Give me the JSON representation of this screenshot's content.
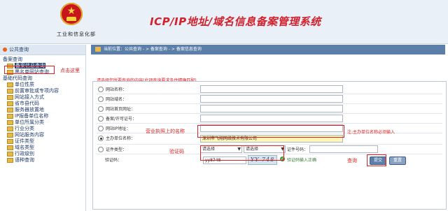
{
  "header": {
    "ministry": "工业和信息化部",
    "title": "ICP/IP地址/域名信息备案管理系统"
  },
  "sidebar": {
    "heading": "公共查询",
    "groups": [
      {
        "title": "备案查询",
        "items": [
          "备案信息查询",
          "黑名单网站查询"
        ]
      },
      {
        "title": "基础代码查询",
        "items": [
          "单位性质",
          "前置审批或专项内容",
          "网站接入方式",
          "省市县代码",
          "服务器放置地",
          "IP报备单位名称",
          "单位所属分类",
          "行业分类",
          "网站服务内容",
          "证件类型",
          "域名类型",
          "行政级别",
          "语种查询"
        ]
      }
    ],
    "annotation": "点击这里"
  },
  "breadcrumb": "当前位置：公共查询 - > 备案查询 - > 备案信息查询",
  "form": {
    "notice": "请选择您所要查询的内容(此项查询要求条件精确匹配)",
    "fields": [
      {
        "label": "网站名称：",
        "value": ""
      },
      {
        "label": "网站域名：",
        "value": ""
      },
      {
        "label": "网站首页网址：",
        "value": ""
      },
      {
        "label": "备案/许可证号：",
        "value": ""
      },
      {
        "label": "网站IP地址：",
        "value": ""
      },
      {
        "label": "主办单位名称：",
        "value": "深圳市飞翔网络技术有限公司"
      }
    ],
    "doc_type_label": "证件类型：",
    "doc_select_1": "请选择",
    "doc_select_2": "请选择",
    "doc_number_label": "证件号码：",
    "captcha_label": "验证码：",
    "captcha_value": "yy8748",
    "captcha_image_text": "YY 748",
    "captcha_ok": "验证码输入正确",
    "submit": "提交",
    "reset": "重置",
    "side_hint": "注:主办单位名称必须输入"
  },
  "annotations": {
    "company_note": "营业执照上的名称",
    "captcha_note": "验证码",
    "query_note": "查询"
  }
}
